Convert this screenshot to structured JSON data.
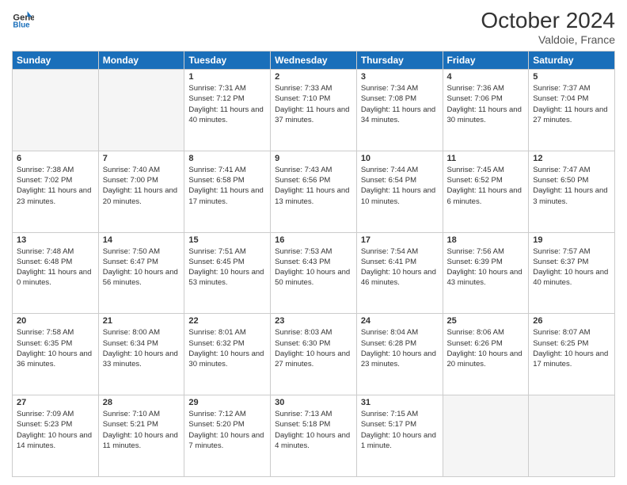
{
  "header": {
    "logo_line1": "General",
    "logo_line2": "Blue",
    "month": "October 2024",
    "location": "Valdoie, France"
  },
  "weekdays": [
    "Sunday",
    "Monday",
    "Tuesday",
    "Wednesday",
    "Thursday",
    "Friday",
    "Saturday"
  ],
  "weeks": [
    [
      {
        "day": "",
        "info": ""
      },
      {
        "day": "",
        "info": ""
      },
      {
        "day": "1",
        "info": "Sunrise: 7:31 AM\nSunset: 7:12 PM\nDaylight: 11 hours and 40 minutes."
      },
      {
        "day": "2",
        "info": "Sunrise: 7:33 AM\nSunset: 7:10 PM\nDaylight: 11 hours and 37 minutes."
      },
      {
        "day": "3",
        "info": "Sunrise: 7:34 AM\nSunset: 7:08 PM\nDaylight: 11 hours and 34 minutes."
      },
      {
        "day": "4",
        "info": "Sunrise: 7:36 AM\nSunset: 7:06 PM\nDaylight: 11 hours and 30 minutes."
      },
      {
        "day": "5",
        "info": "Sunrise: 7:37 AM\nSunset: 7:04 PM\nDaylight: 11 hours and 27 minutes."
      }
    ],
    [
      {
        "day": "6",
        "info": "Sunrise: 7:38 AM\nSunset: 7:02 PM\nDaylight: 11 hours and 23 minutes."
      },
      {
        "day": "7",
        "info": "Sunrise: 7:40 AM\nSunset: 7:00 PM\nDaylight: 11 hours and 20 minutes."
      },
      {
        "day": "8",
        "info": "Sunrise: 7:41 AM\nSunset: 6:58 PM\nDaylight: 11 hours and 17 minutes."
      },
      {
        "day": "9",
        "info": "Sunrise: 7:43 AM\nSunset: 6:56 PM\nDaylight: 11 hours and 13 minutes."
      },
      {
        "day": "10",
        "info": "Sunrise: 7:44 AM\nSunset: 6:54 PM\nDaylight: 11 hours and 10 minutes."
      },
      {
        "day": "11",
        "info": "Sunrise: 7:45 AM\nSunset: 6:52 PM\nDaylight: 11 hours and 6 minutes."
      },
      {
        "day": "12",
        "info": "Sunrise: 7:47 AM\nSunset: 6:50 PM\nDaylight: 11 hours and 3 minutes."
      }
    ],
    [
      {
        "day": "13",
        "info": "Sunrise: 7:48 AM\nSunset: 6:48 PM\nDaylight: 11 hours and 0 minutes."
      },
      {
        "day": "14",
        "info": "Sunrise: 7:50 AM\nSunset: 6:47 PM\nDaylight: 10 hours and 56 minutes."
      },
      {
        "day": "15",
        "info": "Sunrise: 7:51 AM\nSunset: 6:45 PM\nDaylight: 10 hours and 53 minutes."
      },
      {
        "day": "16",
        "info": "Sunrise: 7:53 AM\nSunset: 6:43 PM\nDaylight: 10 hours and 50 minutes."
      },
      {
        "day": "17",
        "info": "Sunrise: 7:54 AM\nSunset: 6:41 PM\nDaylight: 10 hours and 46 minutes."
      },
      {
        "day": "18",
        "info": "Sunrise: 7:56 AM\nSunset: 6:39 PM\nDaylight: 10 hours and 43 minutes."
      },
      {
        "day": "19",
        "info": "Sunrise: 7:57 AM\nSunset: 6:37 PM\nDaylight: 10 hours and 40 minutes."
      }
    ],
    [
      {
        "day": "20",
        "info": "Sunrise: 7:58 AM\nSunset: 6:35 PM\nDaylight: 10 hours and 36 minutes."
      },
      {
        "day": "21",
        "info": "Sunrise: 8:00 AM\nSunset: 6:34 PM\nDaylight: 10 hours and 33 minutes."
      },
      {
        "day": "22",
        "info": "Sunrise: 8:01 AM\nSunset: 6:32 PM\nDaylight: 10 hours and 30 minutes."
      },
      {
        "day": "23",
        "info": "Sunrise: 8:03 AM\nSunset: 6:30 PM\nDaylight: 10 hours and 27 minutes."
      },
      {
        "day": "24",
        "info": "Sunrise: 8:04 AM\nSunset: 6:28 PM\nDaylight: 10 hours and 23 minutes."
      },
      {
        "day": "25",
        "info": "Sunrise: 8:06 AM\nSunset: 6:26 PM\nDaylight: 10 hours and 20 minutes."
      },
      {
        "day": "26",
        "info": "Sunrise: 8:07 AM\nSunset: 6:25 PM\nDaylight: 10 hours and 17 minutes."
      }
    ],
    [
      {
        "day": "27",
        "info": "Sunrise: 7:09 AM\nSunset: 5:23 PM\nDaylight: 10 hours and 14 minutes."
      },
      {
        "day": "28",
        "info": "Sunrise: 7:10 AM\nSunset: 5:21 PM\nDaylight: 10 hours and 11 minutes."
      },
      {
        "day": "29",
        "info": "Sunrise: 7:12 AM\nSunset: 5:20 PM\nDaylight: 10 hours and 7 minutes."
      },
      {
        "day": "30",
        "info": "Sunrise: 7:13 AM\nSunset: 5:18 PM\nDaylight: 10 hours and 4 minutes."
      },
      {
        "day": "31",
        "info": "Sunrise: 7:15 AM\nSunset: 5:17 PM\nDaylight: 10 hours and 1 minute."
      },
      {
        "day": "",
        "info": ""
      },
      {
        "day": "",
        "info": ""
      }
    ]
  ]
}
